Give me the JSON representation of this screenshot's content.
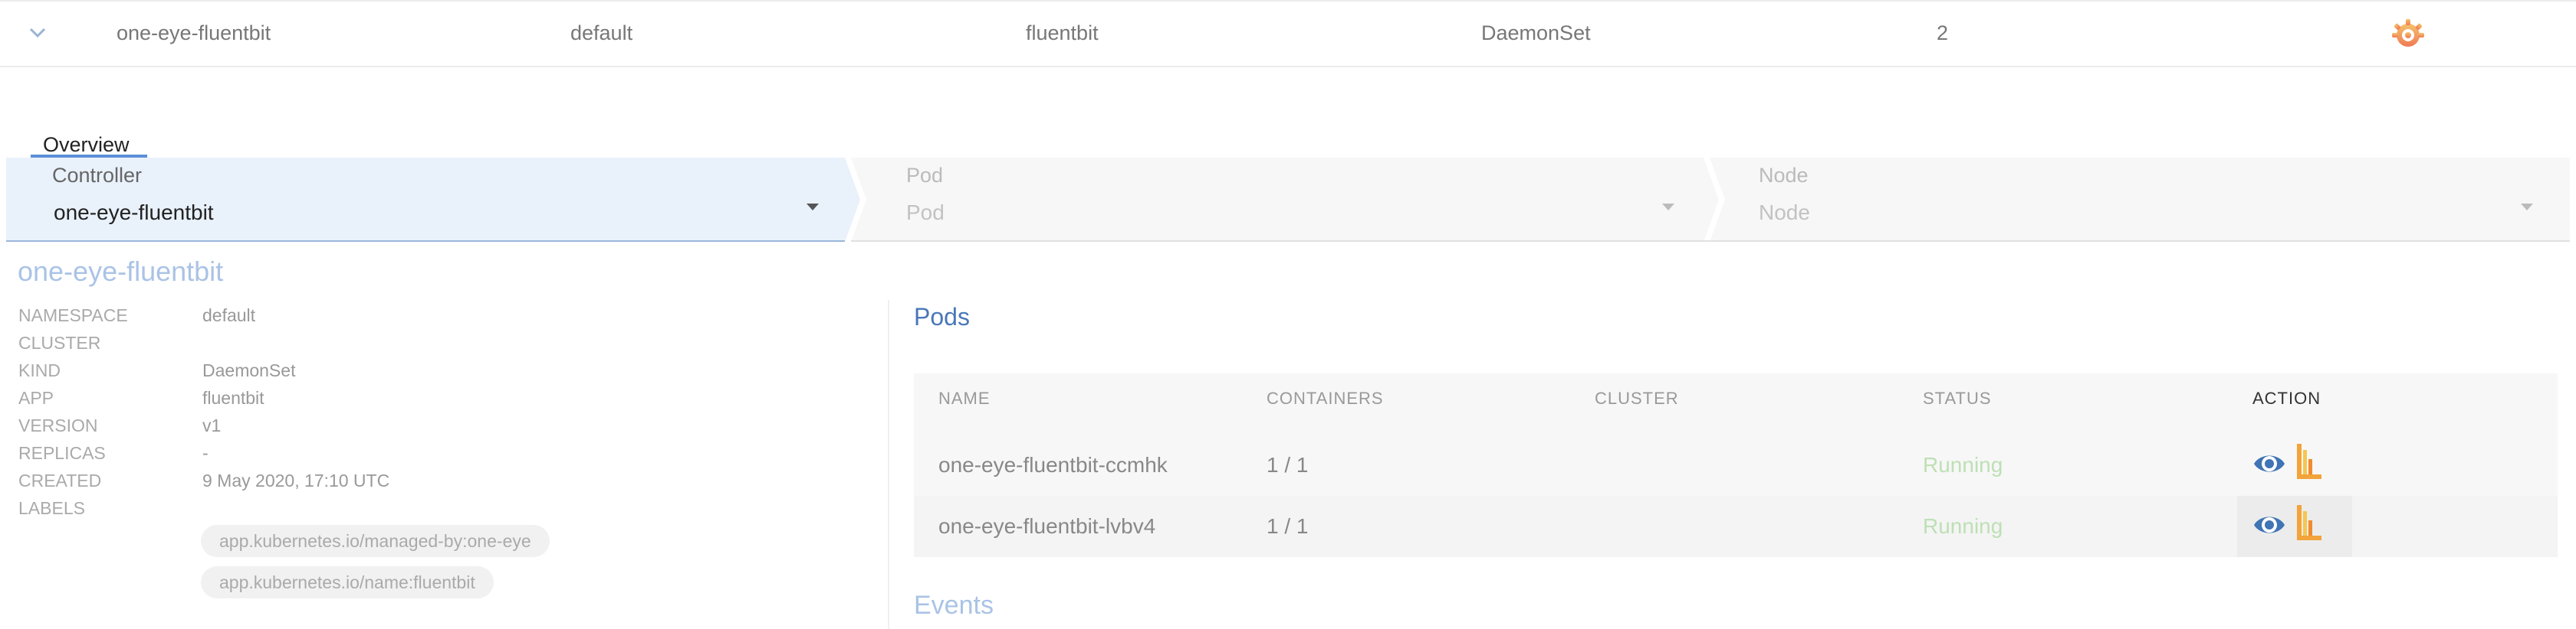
{
  "top_row": {
    "name": "one-eye-fluentbit",
    "namespace": "default",
    "app": "fluentbit",
    "kind": "DaemonSet",
    "replicas": "2",
    "icons": {
      "expand": "chevron-down-icon",
      "grafana": "grafana-icon"
    }
  },
  "tabs": [
    {
      "label": "Overview",
      "active": true
    }
  ],
  "steps": {
    "controller": {
      "label": "Controller",
      "value": "one-eye-fluentbit"
    },
    "pod": {
      "label": "Pod",
      "value": "Pod"
    },
    "node": {
      "label": "Node",
      "value": "Node"
    }
  },
  "detail": {
    "title": "one-eye-fluentbit",
    "fields": [
      {
        "key": "NAMESPACE",
        "value": "default"
      },
      {
        "key": "CLUSTER",
        "value": ""
      },
      {
        "key": "KIND",
        "value": "DaemonSet"
      },
      {
        "key": "APP",
        "value": "fluentbit"
      },
      {
        "key": "VERSION",
        "value": "v1"
      },
      {
        "key": "REPLICAS",
        "value": "-"
      },
      {
        "key": "CREATED",
        "value": "9 May 2020, 17:10 UTC"
      },
      {
        "key": "LABELS",
        "value": ""
      }
    ],
    "labels": [
      "app.kubernetes.io/managed-by:one-eye",
      "app.kubernetes.io/name:fluentbit"
    ]
  },
  "pods": {
    "title": "Pods",
    "columns": [
      "NAME",
      "CONTAINERS",
      "CLUSTER",
      "STATUS",
      "ACTION"
    ],
    "rows": [
      {
        "name": "one-eye-fluentbit-ccmhk",
        "containers": "1 / 1",
        "cluster": "",
        "status": "Running"
      },
      {
        "name": "one-eye-fluentbit-lvbv4",
        "containers": "1 / 1",
        "cluster": "",
        "status": "Running"
      }
    ],
    "action_icons": [
      "eye-icon",
      "flame-icon"
    ]
  },
  "events": {
    "title": "Events"
  },
  "colors": {
    "accent": "#4a78b8",
    "active_step_bg": "#e9f1fb",
    "running": "#bde0b4",
    "eye": "#3f74b5",
    "flame": "#f2a33a"
  }
}
